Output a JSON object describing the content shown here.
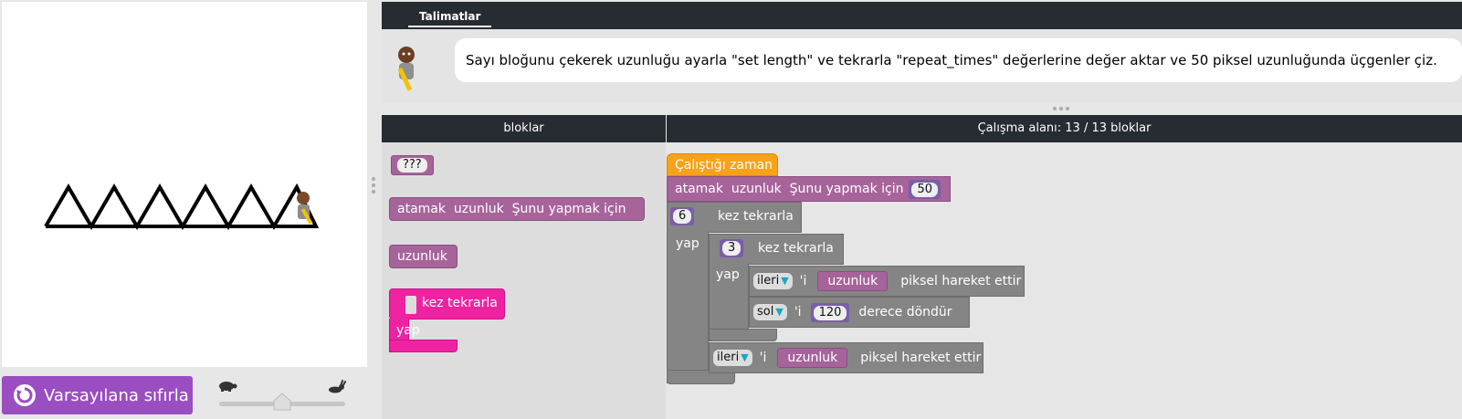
{
  "instructions": {
    "tab_label": "Talimatlar",
    "text": "Sayı bloğunu çekerek uzunluğu ayarla \"set length\" ve tekrarla \"repeat_times\" değerlerine değer aktar ve 50 piksel uzunluğunda üçgenler çiz."
  },
  "controls": {
    "reset_label": "Varsayılana sıfırla",
    "speed_level": 0.5
  },
  "toolbox": {
    "header": "bloklar",
    "unknown_block": "???",
    "set_block": {
      "prefix": "atamak",
      "var": "uzunluk",
      "suffix": "Şunu yapmak için"
    },
    "var_block": "uzunluk",
    "repeat_block": {
      "label": "kez tekrarla",
      "do": "yap"
    }
  },
  "workspace": {
    "header": "Çalışma alanı: 13 / 13 bloklar",
    "when_run": "Çalıştığı zaman",
    "set": {
      "prefix": "atamak",
      "var": "uzunluk",
      "suffix": "Şunu yapmak için",
      "value": "50"
    },
    "outer_repeat": {
      "times": "6",
      "label": "kez tekrarla",
      "do": "yap"
    },
    "inner_repeat": {
      "times": "3",
      "label": "kez tekrarla",
      "do": "yap"
    },
    "move1": {
      "dir": "ileri",
      "apos": "'i",
      "var": "uzunluk",
      "label": "piksel hareket ettir"
    },
    "turn": {
      "dir": "sol",
      "apos": "'i",
      "value": "120",
      "label": "derece döndür"
    },
    "move2": {
      "dir": "ileri",
      "apos": "'i",
      "var": "uzunluk",
      "label": "piksel hareket ettir"
    }
  },
  "colors": {
    "header_bg": "#272b32",
    "reset_btn": "#9a4ec2",
    "variable_block": "#a6649b",
    "turtle_block": "#858585",
    "event_block": "#f7a21a",
    "loop_block": "#ef23a2"
  }
}
